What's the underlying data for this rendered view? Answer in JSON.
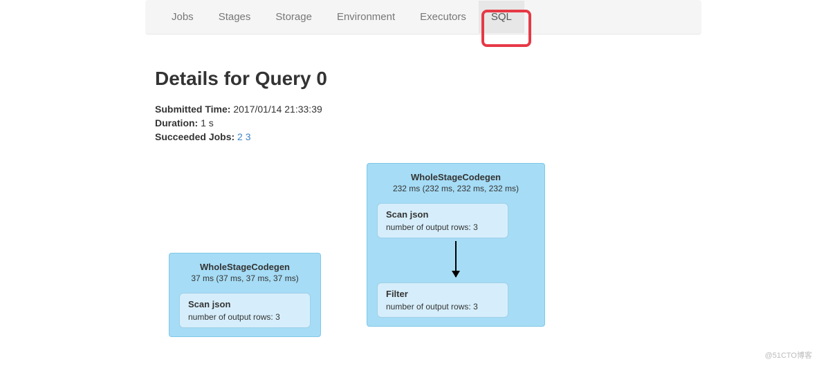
{
  "nav": {
    "items": [
      {
        "label": "Jobs",
        "active": false
      },
      {
        "label": "Stages",
        "active": false
      },
      {
        "label": "Storage",
        "active": false
      },
      {
        "label": "Environment",
        "active": false
      },
      {
        "label": "Executors",
        "active": false
      },
      {
        "label": "SQL",
        "active": true
      }
    ]
  },
  "header": {
    "title": "Details for Query 0",
    "submitted_label": "Submitted Time:",
    "submitted_value": "2017/01/14 21:33:39",
    "duration_label": "Duration:",
    "duration_value": "1 s",
    "succeeded_label": "Succeeded Jobs:",
    "succeeded_jobs": [
      "2",
      "3"
    ]
  },
  "dag": {
    "stages": [
      {
        "title": "WholeStageCodegen",
        "subtitle": "37 ms (37 ms, 37 ms, 37 ms)",
        "ops": [
          {
            "title": "Scan json",
            "detail": "number of output rows: 3"
          }
        ]
      },
      {
        "title": "WholeStageCodegen",
        "subtitle": "232 ms (232 ms, 232 ms, 232 ms)",
        "ops": [
          {
            "title": "Scan json",
            "detail": "number of output rows: 3"
          },
          {
            "title": "Filter",
            "detail": "number of output rows: 3"
          }
        ]
      }
    ]
  },
  "watermark": "@51CTO博客"
}
